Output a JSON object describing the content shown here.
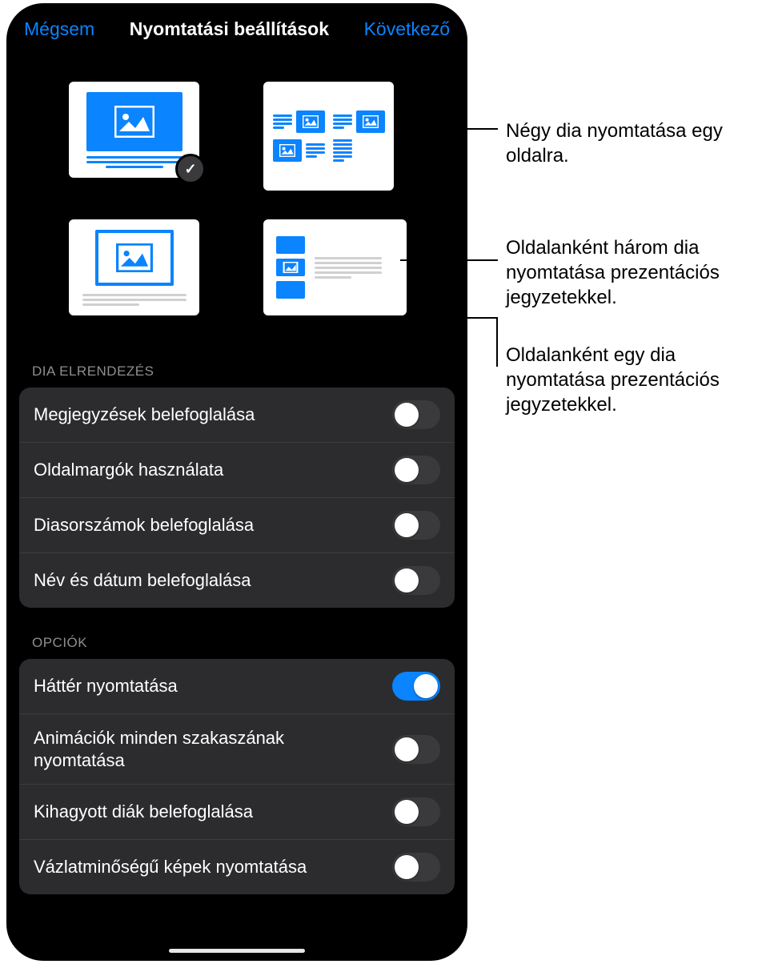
{
  "nav": {
    "cancel": "Mégsem",
    "title": "Nyomtatási beállítások",
    "next": "Következő"
  },
  "layouts": {
    "selected_index": 0
  },
  "sections": {
    "layout_header": "DIA ELRENDEZÉS",
    "options_header": "OPCIÓK"
  },
  "layout_rows": [
    {
      "label": "Megjegyzések belefoglalása",
      "on": false
    },
    {
      "label": "Oldalmargók használata",
      "on": false
    },
    {
      "label": "Diasorszámok belefoglalása",
      "on": false
    },
    {
      "label": "Név és dátum belefoglalása",
      "on": false
    }
  ],
  "option_rows": [
    {
      "label": "Háttér nyomtatása",
      "on": true
    },
    {
      "label": "Animációk minden szakaszának nyomtatása",
      "on": false
    },
    {
      "label": "Kihagyott diák belefoglalása",
      "on": false
    },
    {
      "label": "Vázlatminőségű képek nyomtatása",
      "on": false
    }
  ],
  "callouts": {
    "c1": "Négy dia nyomtatása egy oldalra.",
    "c2": "Oldalanként három dia nyomtatása prezentációs jegyzetekkel.",
    "c3": "Oldalanként egy dia nyomtatása prezentációs jegyzetekkel."
  }
}
